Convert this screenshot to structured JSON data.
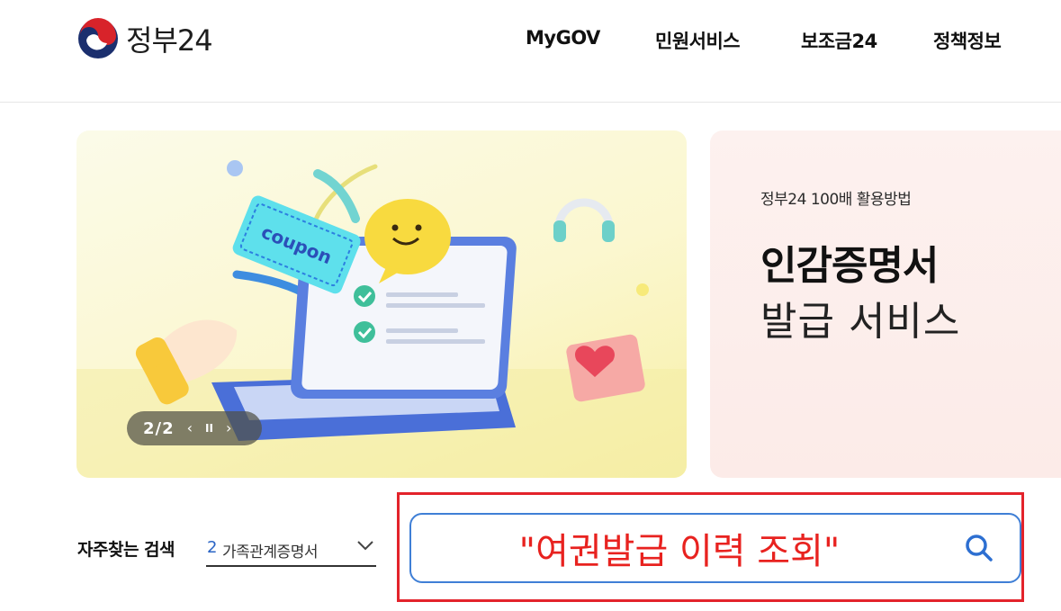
{
  "header": {
    "logo_text": "정부24",
    "nav": [
      "MyGOV",
      "민원서비스",
      "보조금24",
      "정책정보"
    ]
  },
  "banner_main": {
    "coupon_text": "coupon",
    "pager": {
      "count": "2/2",
      "prev": "‹",
      "pause": "II",
      "next": "›"
    }
  },
  "banner_side": {
    "subtitle": "정부24 100배 활용방법",
    "title_line1": "인감증명서",
    "title_line2": "발급 서비스"
  },
  "search": {
    "freq_label": "자주찾는 검색",
    "freq_rank": "2",
    "freq_value": "가족관계증명서",
    "input_value": "\"여권발급 이력 조회\""
  },
  "colors": {
    "accent_blue": "#3f7fd6",
    "highlight_red": "#e3232b",
    "query_red": "#e8221f"
  }
}
